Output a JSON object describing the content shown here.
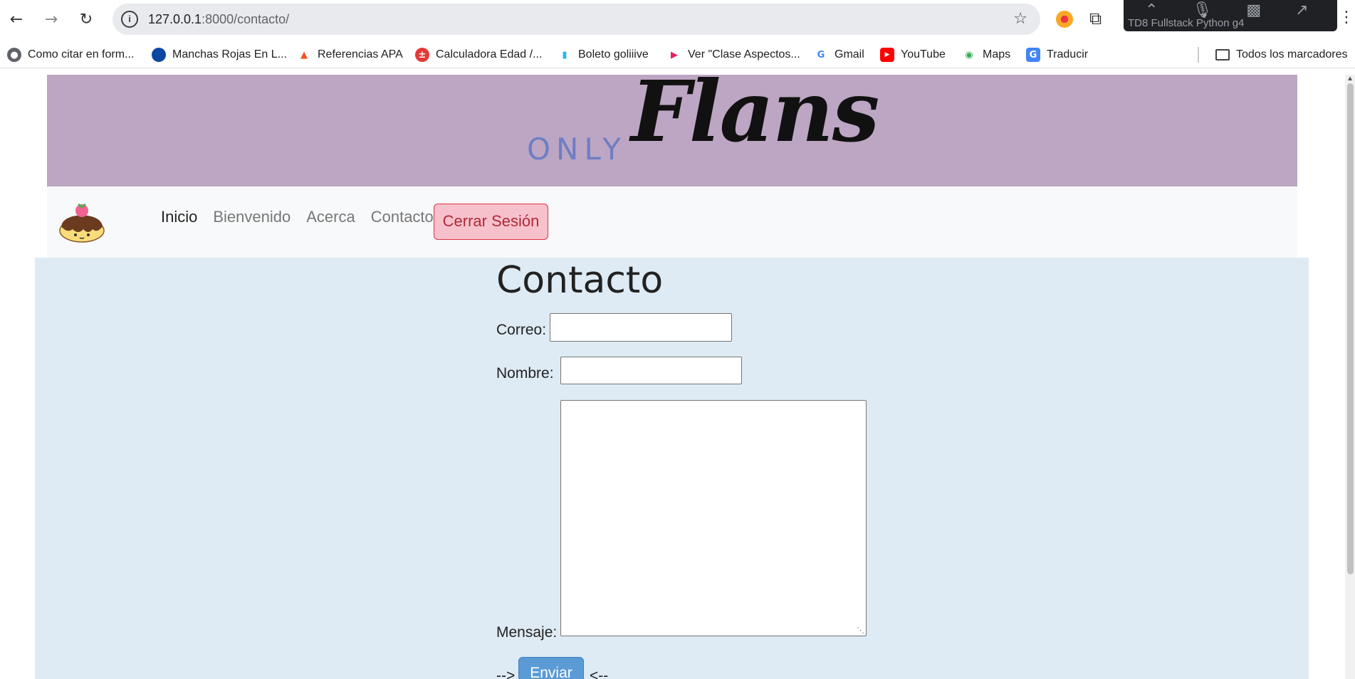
{
  "browser": {
    "url_host": "127.0.0.1",
    "url_path": ":8000/contacto/",
    "meet_label": "TD8 Fullstack Python g4"
  },
  "bookmarks": [
    {
      "label": "Como citar en form...",
      "icon": "globe-icon",
      "color": "#5f6368"
    },
    {
      "label": "Manchas Rojas En L...",
      "icon": "apple-icon",
      "color": "#0d47a1"
    },
    {
      "label": "Referencias APA",
      "icon": "graduation-cap-icon",
      "color": "#f4511e"
    },
    {
      "label": "Calculadora Edad /...",
      "icon": "calculator-icon",
      "color": "#e53935"
    },
    {
      "label": "Boleto goliiive",
      "icon": "bars-icon",
      "color": "#29b6f6"
    },
    {
      "label": "Ver \"Clase Aspectos...",
      "icon": "play-icon",
      "color": "#e91e63"
    },
    {
      "label": "Gmail",
      "icon": "google-icon",
      "color": "#4285f4"
    },
    {
      "label": "YouTube",
      "icon": "youtube-icon",
      "color": "#ff0000"
    },
    {
      "label": "Maps",
      "icon": "maps-pin-icon",
      "color": "#34a853"
    },
    {
      "label": "Traducir",
      "icon": "translate-icon",
      "color": "#4285f4"
    }
  ],
  "all_bookmarks_label": "Todos los marcadores",
  "site": {
    "logo_only": "ONLY",
    "logo_flans": "Flans",
    "nav": [
      "Inicio",
      "Bienvenido",
      "Acerca",
      "Contacto"
    ],
    "logout_label": "Cerrar Sesión"
  },
  "contact_form": {
    "title": "Contacto",
    "email_label": "Correo:",
    "name_label": "Nombre:",
    "message_label": "Mensaje:",
    "arrow_left": "-->",
    "submit_label": "Enviar",
    "arrow_right": "<--"
  },
  "colors": {
    "banner": "#bca6c3",
    "content_bg": "#deebf5",
    "logout_bg": "#f7c1cc",
    "submit_bg": "#5b9bd5"
  }
}
